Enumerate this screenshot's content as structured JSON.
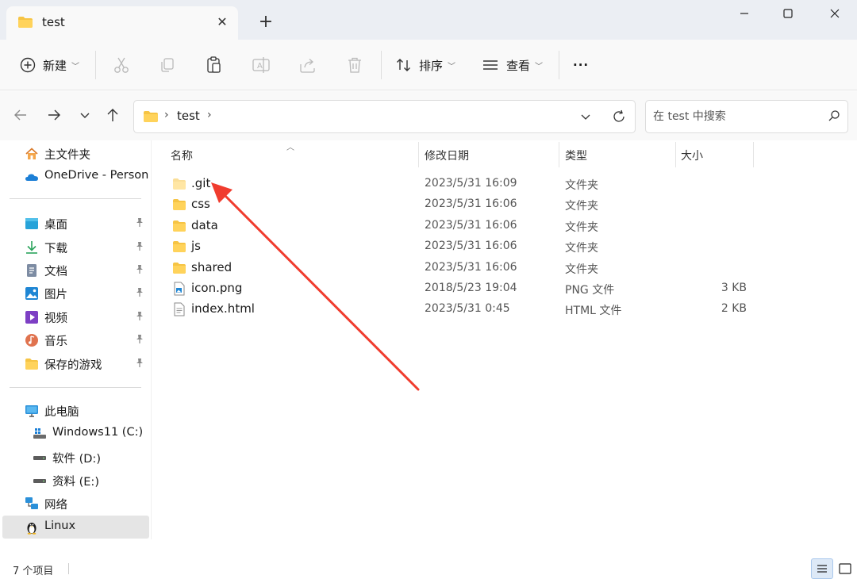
{
  "window": {
    "tab_title": "test",
    "new_tab_label": "+",
    "minimize_label": "—",
    "maximize_label": "□",
    "close_label": "✕"
  },
  "toolbar": {
    "new_label": "新建",
    "sort_label": "排序",
    "view_label": "查看",
    "more_label": "···"
  },
  "address": {
    "segments": [
      "test"
    ],
    "search_placeholder": "在 test 中搜索"
  },
  "sidebar": {
    "quick": [
      {
        "label": "主文件夹",
        "icon": "home-icon"
      },
      {
        "label": "OneDrive - Personal",
        "icon": "onedrive-cloud-icon"
      }
    ],
    "pinned": [
      {
        "label": "桌面",
        "icon": "desktop-icon"
      },
      {
        "label": "下载",
        "icon": "download-icon"
      },
      {
        "label": "文档",
        "icon": "documents-icon"
      },
      {
        "label": "图片",
        "icon": "pictures-icon"
      },
      {
        "label": "视频",
        "icon": "videos-icon"
      },
      {
        "label": "音乐",
        "icon": "music-icon"
      },
      {
        "label": "保存的游戏",
        "icon": "folder-icon"
      }
    ],
    "this_pc": {
      "label": "此电脑",
      "icon": "computer-icon"
    },
    "drives": [
      {
        "label": "Windows11 (C:)",
        "icon": "windows-drive-icon"
      },
      {
        "label": "软件 (D:)",
        "icon": "drive-icon"
      },
      {
        "label": "资料 (E:)",
        "icon": "drive-icon"
      }
    ],
    "network": {
      "label": "网络",
      "icon": "network-icon"
    },
    "linux": {
      "label": "Linux",
      "icon": "linux-penguin-icon"
    }
  },
  "columns": {
    "name": "名称",
    "modified": "修改日期",
    "type": "类型",
    "size": "大小"
  },
  "files": [
    {
      "name": ".git",
      "modified": "2023/5/31 16:09",
      "type": "文件夹",
      "size": "",
      "icon": "hidden-folder-icon"
    },
    {
      "name": "css",
      "modified": "2023/5/31 16:06",
      "type": "文件夹",
      "size": "",
      "icon": "folder-icon"
    },
    {
      "name": "data",
      "modified": "2023/5/31 16:06",
      "type": "文件夹",
      "size": "",
      "icon": "folder-icon"
    },
    {
      "name": "js",
      "modified": "2023/5/31 16:06",
      "type": "文件夹",
      "size": "",
      "icon": "folder-icon"
    },
    {
      "name": "shared",
      "modified": "2023/5/31 16:06",
      "type": "文件夹",
      "size": "",
      "icon": "folder-icon"
    },
    {
      "name": "icon.png",
      "modified": "2018/5/23 19:04",
      "type": "PNG 文件",
      "size": "3 KB",
      "icon": "image-file-icon"
    },
    {
      "name": "index.html",
      "modified": "2023/5/31 0:45",
      "type": "HTML 文件",
      "size": "2 KB",
      "icon": "document-file-icon"
    }
  ],
  "status": {
    "item_count": "7 个项目"
  },
  "colors": {
    "folder": "#f6c444",
    "folder_dark": "#e8a93a",
    "annotation_arrow": "#f03c2e",
    "selected_bg": "#e5e5e5",
    "accent": "#1a73d9"
  }
}
